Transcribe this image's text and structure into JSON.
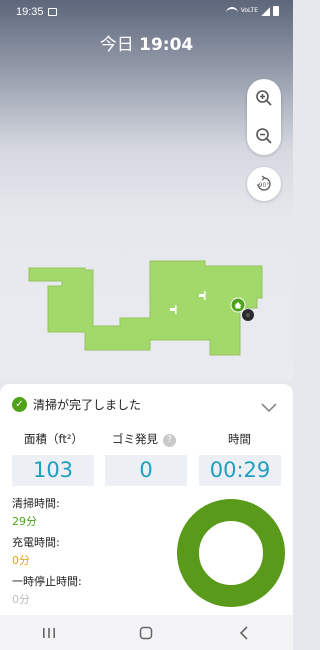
{
  "status_bar": {
    "time": "19:35",
    "volte_label": "VoLTE"
  },
  "header": {
    "day": "今日",
    "time": "19:04"
  },
  "map_controls": {
    "zoom_in": "zoom-in-icon",
    "zoom_out": "zoom-out-icon",
    "rotate_label": "90°"
  },
  "summary": {
    "status_text": "清掃が完了しました",
    "stats": [
      {
        "label": "面積（ft²）",
        "value": "103"
      },
      {
        "label": "ゴミ発見",
        "value": "0",
        "help": "?"
      },
      {
        "label": "時間",
        "value": "00:29"
      }
    ],
    "details": [
      {
        "label": "清掃時間:",
        "value": "29分",
        "color": "#4ea31a"
      },
      {
        "label": "充電時間:",
        "value": "0分",
        "color": "#e3a21a"
      },
      {
        "label": "一時停止時間:",
        "value": "0分",
        "color": "#bdbdbd"
      }
    ]
  },
  "colors": {
    "map_fill": "#a3d96a",
    "accent": "#1f9ec0",
    "donut": "#5a9a1a"
  },
  "nav": {
    "recent": "recent-apps-icon",
    "home": "home-icon",
    "back": "back-icon"
  }
}
